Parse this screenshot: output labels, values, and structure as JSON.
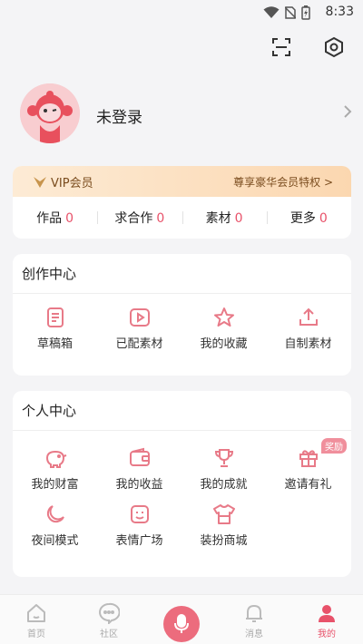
{
  "statusbar": {
    "time": "8:33"
  },
  "topbar": {
    "scan_icon": "scan-icon",
    "settings_icon": "settings-icon"
  },
  "profile": {
    "name": "未登录",
    "avatar_icon": "monkey-avatar-icon"
  },
  "vip": {
    "label": "VIP会员",
    "privilege": "尊享豪华会员特权 >"
  },
  "stats": [
    {
      "label": "作品",
      "value": "0"
    },
    {
      "label": "求合作",
      "value": "0"
    },
    {
      "label": "素材",
      "value": "0"
    },
    {
      "label": "更多",
      "value": "0"
    }
  ],
  "creation": {
    "title": "创作中心",
    "items": [
      {
        "label": "草稿箱",
        "icon": "draft-icon"
      },
      {
        "label": "已配素材",
        "icon": "play-icon"
      },
      {
        "label": "我的收藏",
        "icon": "star-icon"
      },
      {
        "label": "自制素材",
        "icon": "upload-icon"
      }
    ]
  },
  "personal": {
    "title": "个人中心",
    "items": [
      {
        "label": "我的财富",
        "icon": "piggy-bank-icon"
      },
      {
        "label": "我的收益",
        "icon": "wallet-icon"
      },
      {
        "label": "我的成就",
        "icon": "trophy-icon"
      },
      {
        "label": "邀请有礼",
        "icon": "gift-icon",
        "badge": "奖励"
      },
      {
        "label": "夜间模式",
        "icon": "moon-icon"
      },
      {
        "label": "表情广场",
        "icon": "emoji-icon"
      },
      {
        "label": "装扮商城",
        "icon": "shirt-icon"
      }
    ]
  },
  "tabbar": [
    {
      "label": "首页",
      "icon": "home-icon"
    },
    {
      "label": "社区",
      "icon": "community-icon"
    },
    {
      "label": "",
      "icon": "mic-icon"
    },
    {
      "label": "消息",
      "icon": "bell-icon"
    },
    {
      "label": "我的",
      "icon": "user-icon",
      "active": true
    }
  ],
  "colors": {
    "accent": "#e8526a",
    "icon_stroke": "#e87a88",
    "vip_text": "#7a4c1e"
  }
}
